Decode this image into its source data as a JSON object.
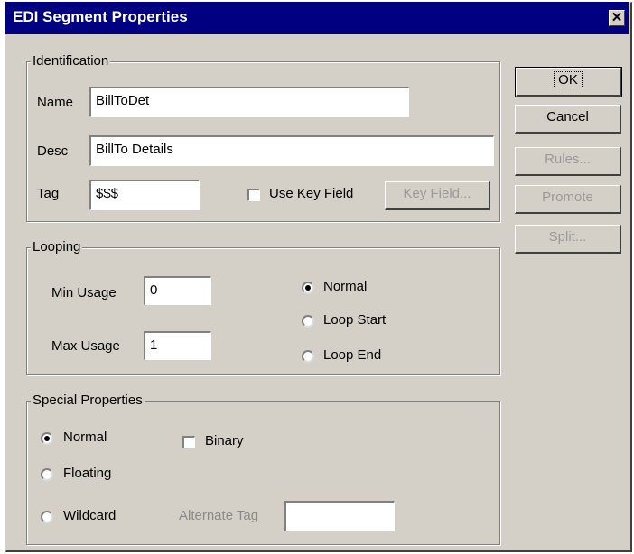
{
  "window": {
    "title": "EDI Segment Properties",
    "close_glyph": "✕"
  },
  "identification": {
    "legend": "Identification",
    "name_label": "Name",
    "name_value": "BillToDet",
    "desc_label": "Desc",
    "desc_value": "BillTo Details",
    "tag_label": "Tag",
    "tag_value": "$$$",
    "use_key_field_label": "Use Key Field",
    "use_key_field_checked": false,
    "key_field_button": "Key Field..."
  },
  "looping": {
    "legend": "Looping",
    "min_label": "Min Usage",
    "min_value": "0",
    "max_label": "Max Usage",
    "max_value": "1",
    "options": [
      "Normal",
      "Loop Start",
      "Loop End"
    ],
    "selected": "Normal"
  },
  "special": {
    "legend": "Special Properties",
    "options": [
      "Normal",
      "Floating",
      "Wildcard"
    ],
    "selected": "Normal",
    "binary_label": "Binary",
    "binary_checked": false,
    "alternate_tag_label": "Alternate Tag",
    "alternate_tag_value": ""
  },
  "buttons": {
    "ok": "OK",
    "cancel": "Cancel",
    "rules": "Rules...",
    "promote": "Promote",
    "split": "Split..."
  }
}
